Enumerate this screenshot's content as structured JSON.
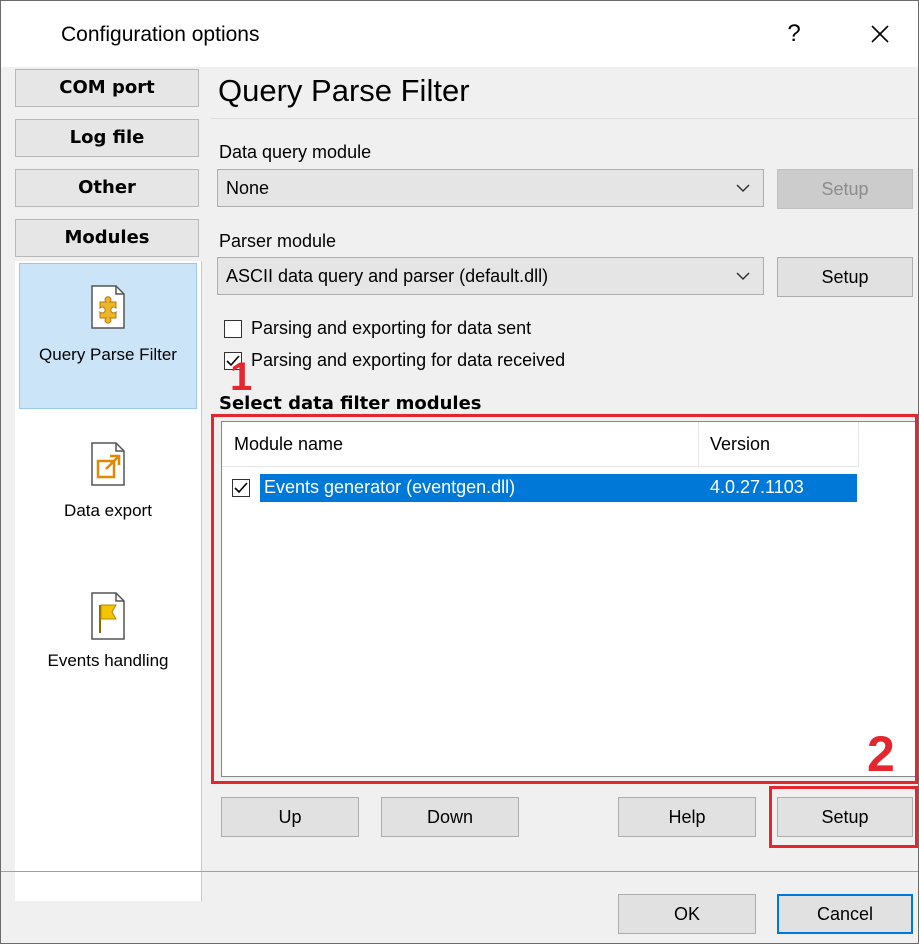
{
  "window": {
    "title": "Configuration options",
    "help_glyph": "?",
    "close_glyph": "✕"
  },
  "nav": {
    "buttons": [
      "COM port",
      "Log file",
      "Other",
      "Modules"
    ],
    "tiles": [
      {
        "label": "Query Parse Filter",
        "icon": "puzzle-icon",
        "selected": true
      },
      {
        "label": "Data export",
        "icon": "export-icon",
        "selected": false
      },
      {
        "label": "Events handling",
        "icon": "flag-icon",
        "selected": false
      }
    ]
  },
  "main": {
    "heading": "Query Parse Filter",
    "data_query": {
      "label": "Data query module",
      "value": "None",
      "setup_label": "Setup",
      "setup_enabled": false
    },
    "parser": {
      "label": "Parser module",
      "value": "ASCII data query and parser (default.dll)",
      "setup_label": "Setup"
    },
    "checks": [
      {
        "label": "Parsing and exporting for data sent",
        "checked": false
      },
      {
        "label": "Parsing and exporting for data received",
        "checked": true
      }
    ],
    "filter_section_label": "Select data filter modules",
    "list": {
      "columns": [
        "Module name",
        "Version"
      ],
      "rows": [
        {
          "name": "Events generator (eventgen.dll)",
          "version": "4.0.27.1103",
          "checked": true,
          "selected": true
        }
      ]
    },
    "buttons": {
      "up": "Up",
      "down": "Down",
      "help": "Help",
      "setup": "Setup"
    }
  },
  "annotations": {
    "marker1": "1",
    "marker2": "2",
    "color": "#e5262e"
  },
  "footer": {
    "ok": "OK",
    "cancel": "Cancel"
  },
  "colors": {
    "selection": "#0078d7",
    "tile_selected": "#cce4f7"
  }
}
